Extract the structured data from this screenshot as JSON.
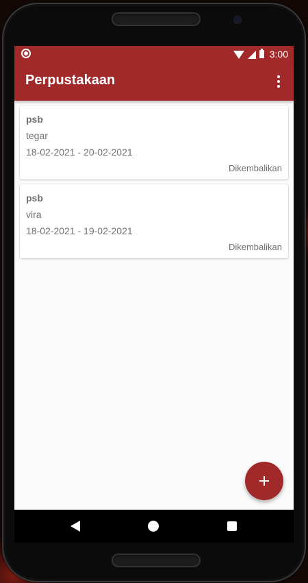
{
  "statusbar": {
    "time": "3:00",
    "icons": [
      "notification-icon",
      "wifi-icon",
      "signal-icon",
      "battery-icon"
    ]
  },
  "appbar": {
    "title": "Perpustakaan",
    "menu_icon": "more-vert-icon"
  },
  "loans": [
    {
      "title": "psb",
      "name": "tegar",
      "dates": "18-02-2021 - 20-02-2021",
      "status": "Dikembalikan"
    },
    {
      "title": "psb",
      "name": "vira",
      "dates": "18-02-2021 - 19-02-2021",
      "status": "Dikembalikan"
    }
  ],
  "fab": {
    "icon": "plus-icon"
  },
  "navbar": {
    "icons": [
      "back-icon",
      "home-icon",
      "recents-icon"
    ]
  },
  "colors": {
    "primary": "#a1292a",
    "background": "#fafafa",
    "text_secondary": "#707070"
  }
}
